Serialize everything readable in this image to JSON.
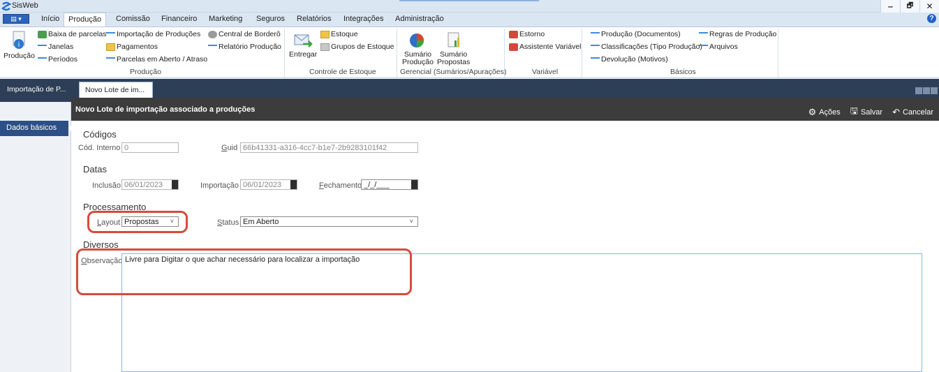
{
  "app": {
    "title": "SisWeb"
  },
  "window_controls": {
    "minimize": "‒",
    "maximize": "🗗",
    "close": "✕"
  },
  "menu": {
    "tabs": [
      "Início",
      "Produção",
      "Comissão",
      "Financeiro",
      "Marketing",
      "Seguros",
      "Relatórios",
      "Integrações",
      "Administração"
    ],
    "active": "Produção",
    "help": "?"
  },
  "ribbon": {
    "producao_group": {
      "big_button": "Produção",
      "items_col1": [
        "Baixa de parcelas",
        "Janelas",
        "Períodos"
      ],
      "items_col2": [
        "Importação de Produções",
        "Pagamentos",
        "Parcelas em Aberto / Atraso"
      ],
      "items_col3": [
        "Central de Borderô",
        "Relatório Produção"
      ],
      "label": "Produção"
    },
    "estoque_group": {
      "big_button": "Entregar",
      "items": [
        "Estoque",
        "Grupos de Estoque"
      ],
      "label": "Controle de Estoque"
    },
    "gerencial_group": {
      "buttons": [
        {
          "line1": "Sumário",
          "line2": "Produção"
        },
        {
          "line1": "Sumário",
          "line2": "Propostas"
        }
      ],
      "label": "Gerencial (Sumários/Apurações)"
    },
    "variavel_group": {
      "items": [
        "Estorno",
        "Assistente Variável"
      ],
      "label": "Variável"
    },
    "basicos_group": {
      "items_col1": [
        "Produção (Documentos)",
        "Classificações (Tipo Produção)",
        "Devolução (Motivos)"
      ],
      "items_col2": [
        "Regras de Produção",
        "Arquivos"
      ],
      "label": "Básicos"
    }
  },
  "doc_tabs": [
    "Importação de P...",
    "Novo Lote de im..."
  ],
  "left_panel": {
    "items": [
      "Dados básicos"
    ]
  },
  "form": {
    "title": "Novo Lote de importação associado a produções",
    "actions": {
      "acoes": "Ações",
      "salvar": "Salvar",
      "cancelar": "Cancelar"
    },
    "codigos": {
      "heading": "Códigos",
      "cod_interno_label": "Cód. Interno",
      "cod_interno_value": "0",
      "guid_label": "Guid",
      "guid_value": "66b41331-a316-4cc7-b1e7-2b9283101f42"
    },
    "datas": {
      "heading": "Datas",
      "inclusao_label": "Inclusão",
      "inclusao_value": "06/01/2023",
      "importacao_label": "Importação",
      "importacao_value": "06/01/2023",
      "fechamento_label": "Fechamento",
      "fechamento_value": "_/_/___"
    },
    "processamento": {
      "heading": "Processamento",
      "layout_label": "Layout",
      "layout_value": "Propostas",
      "status_label": "Status",
      "status_value": "Em Aberto"
    },
    "diversos": {
      "heading": "Diversos",
      "observacao_label": "Observação",
      "observacao_value": "Livre para Digitar o que achar necessário para localizar a importação"
    }
  }
}
